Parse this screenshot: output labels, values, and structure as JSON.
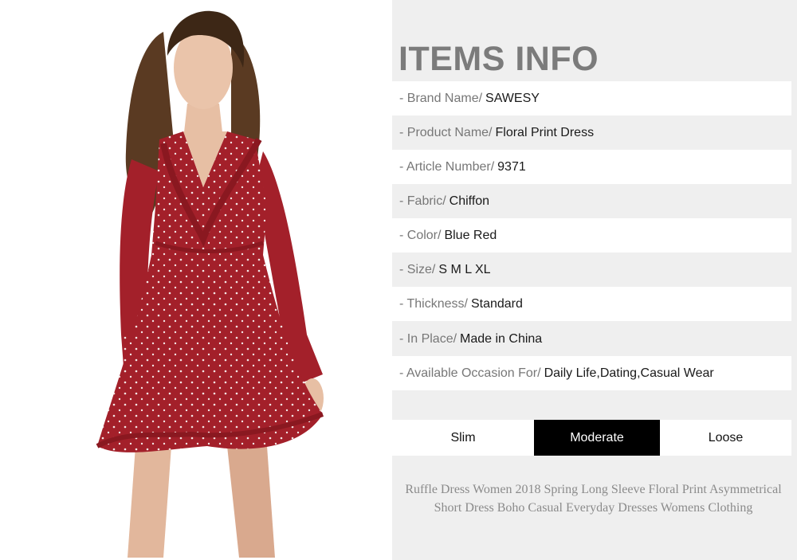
{
  "info": {
    "title": "ITEMS INFO",
    "specs": [
      {
        "label": "- Brand Name/",
        "value": "SAWESY"
      },
      {
        "label": "- Product Name/",
        "value": "Floral Print Dress"
      },
      {
        "label": "- Article Number/",
        "value": "9371"
      },
      {
        "label": "- Fabric/",
        "value": "Chiffon"
      },
      {
        "label": "- Color/",
        "value": "Blue Red"
      },
      {
        "label": "- Size/",
        "value": "S M L XL"
      },
      {
        "label": "- Thickness/",
        "value": "Standard"
      },
      {
        "label": "- In Place/",
        "value": "Made in China"
      },
      {
        "label": "- Available Occasion For/",
        "value": "Daily Life,Dating,Casual Wear"
      }
    ],
    "fit": {
      "options": [
        "Slim",
        "Moderate",
        "Loose"
      ],
      "selected": "Moderate"
    },
    "description": "Ruffle Dress Women 2018 Spring Long Sleeve Floral Print Asymmetrical Short Dress Boho Casual Everyday Dresses Womens Clothing"
  },
  "colors": {
    "dress": "#a3202a",
    "panel": "#efefef",
    "title": "#7b7b7b",
    "active_fit": "#000000"
  }
}
